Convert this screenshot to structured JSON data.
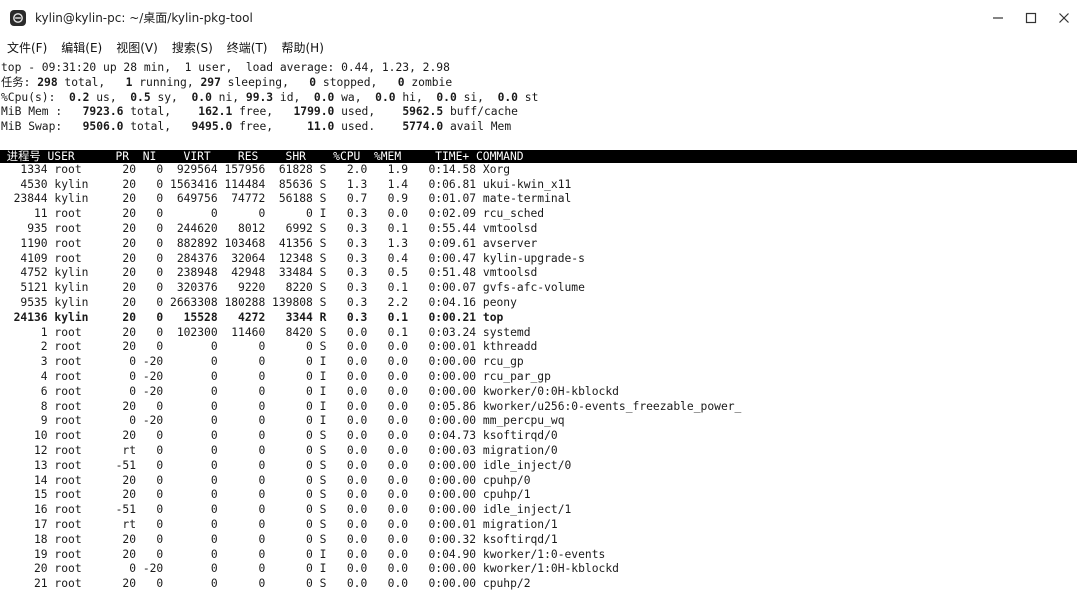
{
  "window": {
    "title": "kylin@kylin-pc: ~/桌面/kylin-pkg-tool"
  },
  "menu": [
    "文件(F)",
    "编辑(E)",
    "视图(V)",
    "搜索(S)",
    "终端(T)",
    "帮助(H)"
  ],
  "summary": {
    "line1": "top - 09:31:20 up 28 min,  1 user,  load average: 0.44, 1.23, 2.98",
    "tasks": {
      "label": "任务:",
      "total": "298",
      "running": "1",
      "sleeping": "297",
      "stopped": "0",
      "zombie": "0"
    },
    "cpu": {
      "label": "%Cpu(s):",
      "us": "0.2",
      "sy": "0.5",
      "ni": "0.0",
      "id": "99.3",
      "wa": "0.0",
      "hi": "0.0",
      "si": "0.0",
      "st": "0.0"
    },
    "mem": {
      "label": "MiB Mem :",
      "total": "7923.6",
      "free": "162.1",
      "used": "1799.0",
      "buff_cache": "5962.5"
    },
    "swap": {
      "label": "MiB Swap:",
      "total": "9506.0",
      "free": "9495.0",
      "used": "11.0",
      "avail": "5774.0"
    }
  },
  "columns": [
    "进程号",
    "USER",
    "PR",
    "NI",
    "VIRT",
    "RES",
    "SHR",
    "%CPU",
    "%MEM",
    "TIME+",
    "COMMAND"
  ],
  "processes": [
    {
      "pid": "1334",
      "user": "root",
      "pr": "20",
      "ni": "0",
      "virt": "929564",
      "res": "157956",
      "shr": "61828",
      "s": "S",
      "cpu": "2.0",
      "mem": "1.9",
      "time": "0:14.58",
      "cmd": "Xorg"
    },
    {
      "pid": "4530",
      "user": "kylin",
      "pr": "20",
      "ni": "0",
      "virt": "1563416",
      "res": "114484",
      "shr": "85636",
      "s": "S",
      "cpu": "1.3",
      "mem": "1.4",
      "time": "0:06.81",
      "cmd": "ukui-kwin_x11"
    },
    {
      "pid": "23844",
      "user": "kylin",
      "pr": "20",
      "ni": "0",
      "virt": "649756",
      "res": "74772",
      "shr": "56188",
      "s": "S",
      "cpu": "0.7",
      "mem": "0.9",
      "time": "0:01.07",
      "cmd": "mate-terminal"
    },
    {
      "pid": "11",
      "user": "root",
      "pr": "20",
      "ni": "0",
      "virt": "0",
      "res": "0",
      "shr": "0",
      "s": "I",
      "cpu": "0.3",
      "mem": "0.0",
      "time": "0:02.09",
      "cmd": "rcu_sched"
    },
    {
      "pid": "935",
      "user": "root",
      "pr": "20",
      "ni": "0",
      "virt": "244620",
      "res": "8012",
      "shr": "6992",
      "s": "S",
      "cpu": "0.3",
      "mem": "0.1",
      "time": "0:55.44",
      "cmd": "vmtoolsd"
    },
    {
      "pid": "1190",
      "user": "root",
      "pr": "20",
      "ni": "0",
      "virt": "882892",
      "res": "103468",
      "shr": "41356",
      "s": "S",
      "cpu": "0.3",
      "mem": "1.3",
      "time": "0:09.61",
      "cmd": "avserver"
    },
    {
      "pid": "4109",
      "user": "root",
      "pr": "20",
      "ni": "0",
      "virt": "284376",
      "res": "32064",
      "shr": "12348",
      "s": "S",
      "cpu": "0.3",
      "mem": "0.4",
      "time": "0:00.47",
      "cmd": "kylin-upgrade-s"
    },
    {
      "pid": "4752",
      "user": "kylin",
      "pr": "20",
      "ni": "0",
      "virt": "238948",
      "res": "42948",
      "shr": "33484",
      "s": "S",
      "cpu": "0.3",
      "mem": "0.5",
      "time": "0:51.48",
      "cmd": "vmtoolsd"
    },
    {
      "pid": "5121",
      "user": "kylin",
      "pr": "20",
      "ni": "0",
      "virt": "320376",
      "res": "9220",
      "shr": "8220",
      "s": "S",
      "cpu": "0.3",
      "mem": "0.1",
      "time": "0:00.07",
      "cmd": "gvfs-afc-volume"
    },
    {
      "pid": "9535",
      "user": "kylin",
      "pr": "20",
      "ni": "0",
      "virt": "2663308",
      "res": "180288",
      "shr": "139808",
      "s": "S",
      "cpu": "0.3",
      "mem": "2.2",
      "time": "0:04.16",
      "cmd": "peony"
    },
    {
      "pid": "24136",
      "user": "kylin",
      "pr": "20",
      "ni": "0",
      "virt": "15528",
      "res": "4272",
      "shr": "3344",
      "s": "R",
      "cpu": "0.3",
      "mem": "0.1",
      "time": "0:00.21",
      "cmd": "top",
      "bold": true
    },
    {
      "pid": "1",
      "user": "root",
      "pr": "20",
      "ni": "0",
      "virt": "102300",
      "res": "11460",
      "shr": "8420",
      "s": "S",
      "cpu": "0.0",
      "mem": "0.1",
      "time": "0:03.24",
      "cmd": "systemd"
    },
    {
      "pid": "2",
      "user": "root",
      "pr": "20",
      "ni": "0",
      "virt": "0",
      "res": "0",
      "shr": "0",
      "s": "S",
      "cpu": "0.0",
      "mem": "0.0",
      "time": "0:00.01",
      "cmd": "kthreadd"
    },
    {
      "pid": "3",
      "user": "root",
      "pr": "0",
      "ni": "-20",
      "virt": "0",
      "res": "0",
      "shr": "0",
      "s": "I",
      "cpu": "0.0",
      "mem": "0.0",
      "time": "0:00.00",
      "cmd": "rcu_gp"
    },
    {
      "pid": "4",
      "user": "root",
      "pr": "0",
      "ni": "-20",
      "virt": "0",
      "res": "0",
      "shr": "0",
      "s": "I",
      "cpu": "0.0",
      "mem": "0.0",
      "time": "0:00.00",
      "cmd": "rcu_par_gp"
    },
    {
      "pid": "6",
      "user": "root",
      "pr": "0",
      "ni": "-20",
      "virt": "0",
      "res": "0",
      "shr": "0",
      "s": "I",
      "cpu": "0.0",
      "mem": "0.0",
      "time": "0:00.00",
      "cmd": "kworker/0:0H-kblockd"
    },
    {
      "pid": "8",
      "user": "root",
      "pr": "20",
      "ni": "0",
      "virt": "0",
      "res": "0",
      "shr": "0",
      "s": "I",
      "cpu": "0.0",
      "mem": "0.0",
      "time": "0:05.86",
      "cmd": "kworker/u256:0-events_freezable_power_"
    },
    {
      "pid": "9",
      "user": "root",
      "pr": "0",
      "ni": "-20",
      "virt": "0",
      "res": "0",
      "shr": "0",
      "s": "I",
      "cpu": "0.0",
      "mem": "0.0",
      "time": "0:00.00",
      "cmd": "mm_percpu_wq"
    },
    {
      "pid": "10",
      "user": "root",
      "pr": "20",
      "ni": "0",
      "virt": "0",
      "res": "0",
      "shr": "0",
      "s": "S",
      "cpu": "0.0",
      "mem": "0.0",
      "time": "0:04.73",
      "cmd": "ksoftirqd/0"
    },
    {
      "pid": "12",
      "user": "root",
      "pr": "rt",
      "ni": "0",
      "virt": "0",
      "res": "0",
      "shr": "0",
      "s": "S",
      "cpu": "0.0",
      "mem": "0.0",
      "time": "0:00.03",
      "cmd": "migration/0"
    },
    {
      "pid": "13",
      "user": "root",
      "pr": "-51",
      "ni": "0",
      "virt": "0",
      "res": "0",
      "shr": "0",
      "s": "S",
      "cpu": "0.0",
      "mem": "0.0",
      "time": "0:00.00",
      "cmd": "idle_inject/0"
    },
    {
      "pid": "14",
      "user": "root",
      "pr": "20",
      "ni": "0",
      "virt": "0",
      "res": "0",
      "shr": "0",
      "s": "S",
      "cpu": "0.0",
      "mem": "0.0",
      "time": "0:00.00",
      "cmd": "cpuhp/0"
    },
    {
      "pid": "15",
      "user": "root",
      "pr": "20",
      "ni": "0",
      "virt": "0",
      "res": "0",
      "shr": "0",
      "s": "S",
      "cpu": "0.0",
      "mem": "0.0",
      "time": "0:00.00",
      "cmd": "cpuhp/1"
    },
    {
      "pid": "16",
      "user": "root",
      "pr": "-51",
      "ni": "0",
      "virt": "0",
      "res": "0",
      "shr": "0",
      "s": "S",
      "cpu": "0.0",
      "mem": "0.0",
      "time": "0:00.00",
      "cmd": "idle_inject/1"
    },
    {
      "pid": "17",
      "user": "root",
      "pr": "rt",
      "ni": "0",
      "virt": "0",
      "res": "0",
      "shr": "0",
      "s": "S",
      "cpu": "0.0",
      "mem": "0.0",
      "time": "0:00.01",
      "cmd": "migration/1"
    },
    {
      "pid": "18",
      "user": "root",
      "pr": "20",
      "ni": "0",
      "virt": "0",
      "res": "0",
      "shr": "0",
      "s": "S",
      "cpu": "0.0",
      "mem": "0.0",
      "time": "0:00.32",
      "cmd": "ksoftirqd/1"
    },
    {
      "pid": "19",
      "user": "root",
      "pr": "20",
      "ni": "0",
      "virt": "0",
      "res": "0",
      "shr": "0",
      "s": "I",
      "cpu": "0.0",
      "mem": "0.0",
      "time": "0:04.90",
      "cmd": "kworker/1:0-events"
    },
    {
      "pid": "20",
      "user": "root",
      "pr": "0",
      "ni": "-20",
      "virt": "0",
      "res": "0",
      "shr": "0",
      "s": "I",
      "cpu": "0.0",
      "mem": "0.0",
      "time": "0:00.00",
      "cmd": "kworker/1:0H-kblockd"
    },
    {
      "pid": "21",
      "user": "root",
      "pr": "20",
      "ni": "0",
      "virt": "0",
      "res": "0",
      "shr": "0",
      "s": "S",
      "cpu": "0.0",
      "mem": "0.0",
      "time": "0:00.00",
      "cmd": "cpuhp/2"
    }
  ]
}
